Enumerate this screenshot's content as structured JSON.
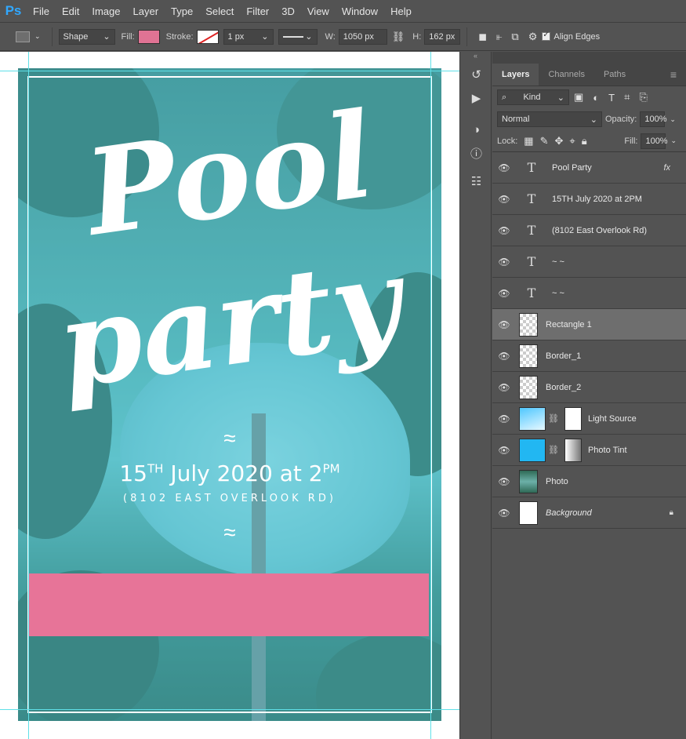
{
  "menu": [
    "File",
    "Edit",
    "Image",
    "Layer",
    "Type",
    "Select",
    "Filter",
    "3D",
    "View",
    "Window",
    "Help"
  ],
  "options": {
    "mode": "Shape",
    "fill_label": "Fill:",
    "stroke_label": "Stroke:",
    "stroke_width": "1 px",
    "w_label": "W:",
    "width": "1050 px",
    "h_label": "H:",
    "height": "162 px",
    "align_edges": "Align Edges"
  },
  "poster": {
    "title1": "Pool",
    "title2": "party",
    "squiggle": "≈",
    "date_day": "15",
    "date_suffix": "TH",
    "date_main": "July 2020 at 2",
    "date_pm": "PM",
    "address": "(8102 EAST OVERLOOK RD)"
  },
  "panel": {
    "tabs": [
      "Layers",
      "Channels",
      "Paths"
    ],
    "kind": "Kind",
    "blend": "Normal",
    "opacity_label": "Opacity:",
    "opacity": "100%",
    "lock_label": "Lock:",
    "fill_label": "Fill:",
    "fill": "100%",
    "fx": "fx"
  },
  "layers": [
    {
      "name": "Pool  Party",
      "type": "text"
    },
    {
      "name": "15TH July 2020 at 2PM",
      "type": "text"
    },
    {
      "name": "(8102 East Overlook Rd)",
      "type": "text"
    },
    {
      "name": "~ ~",
      "type": "text"
    },
    {
      "name": "~ ~",
      "type": "text"
    },
    {
      "name": "Rectangle 1",
      "type": "shape"
    },
    {
      "name": "Border_1",
      "type": "shape"
    },
    {
      "name": "Border_2",
      "type": "shape"
    },
    {
      "name": "Light Source",
      "type": "adjust"
    },
    {
      "name": "Photo Tint",
      "type": "adjust"
    },
    {
      "name": "Photo",
      "type": "photo"
    },
    {
      "name": "Background",
      "type": "bg"
    }
  ],
  "colors": {
    "accent_pink": "#e77498",
    "guide": "#5fe0e8",
    "ps_blue": "#31a8ff"
  }
}
